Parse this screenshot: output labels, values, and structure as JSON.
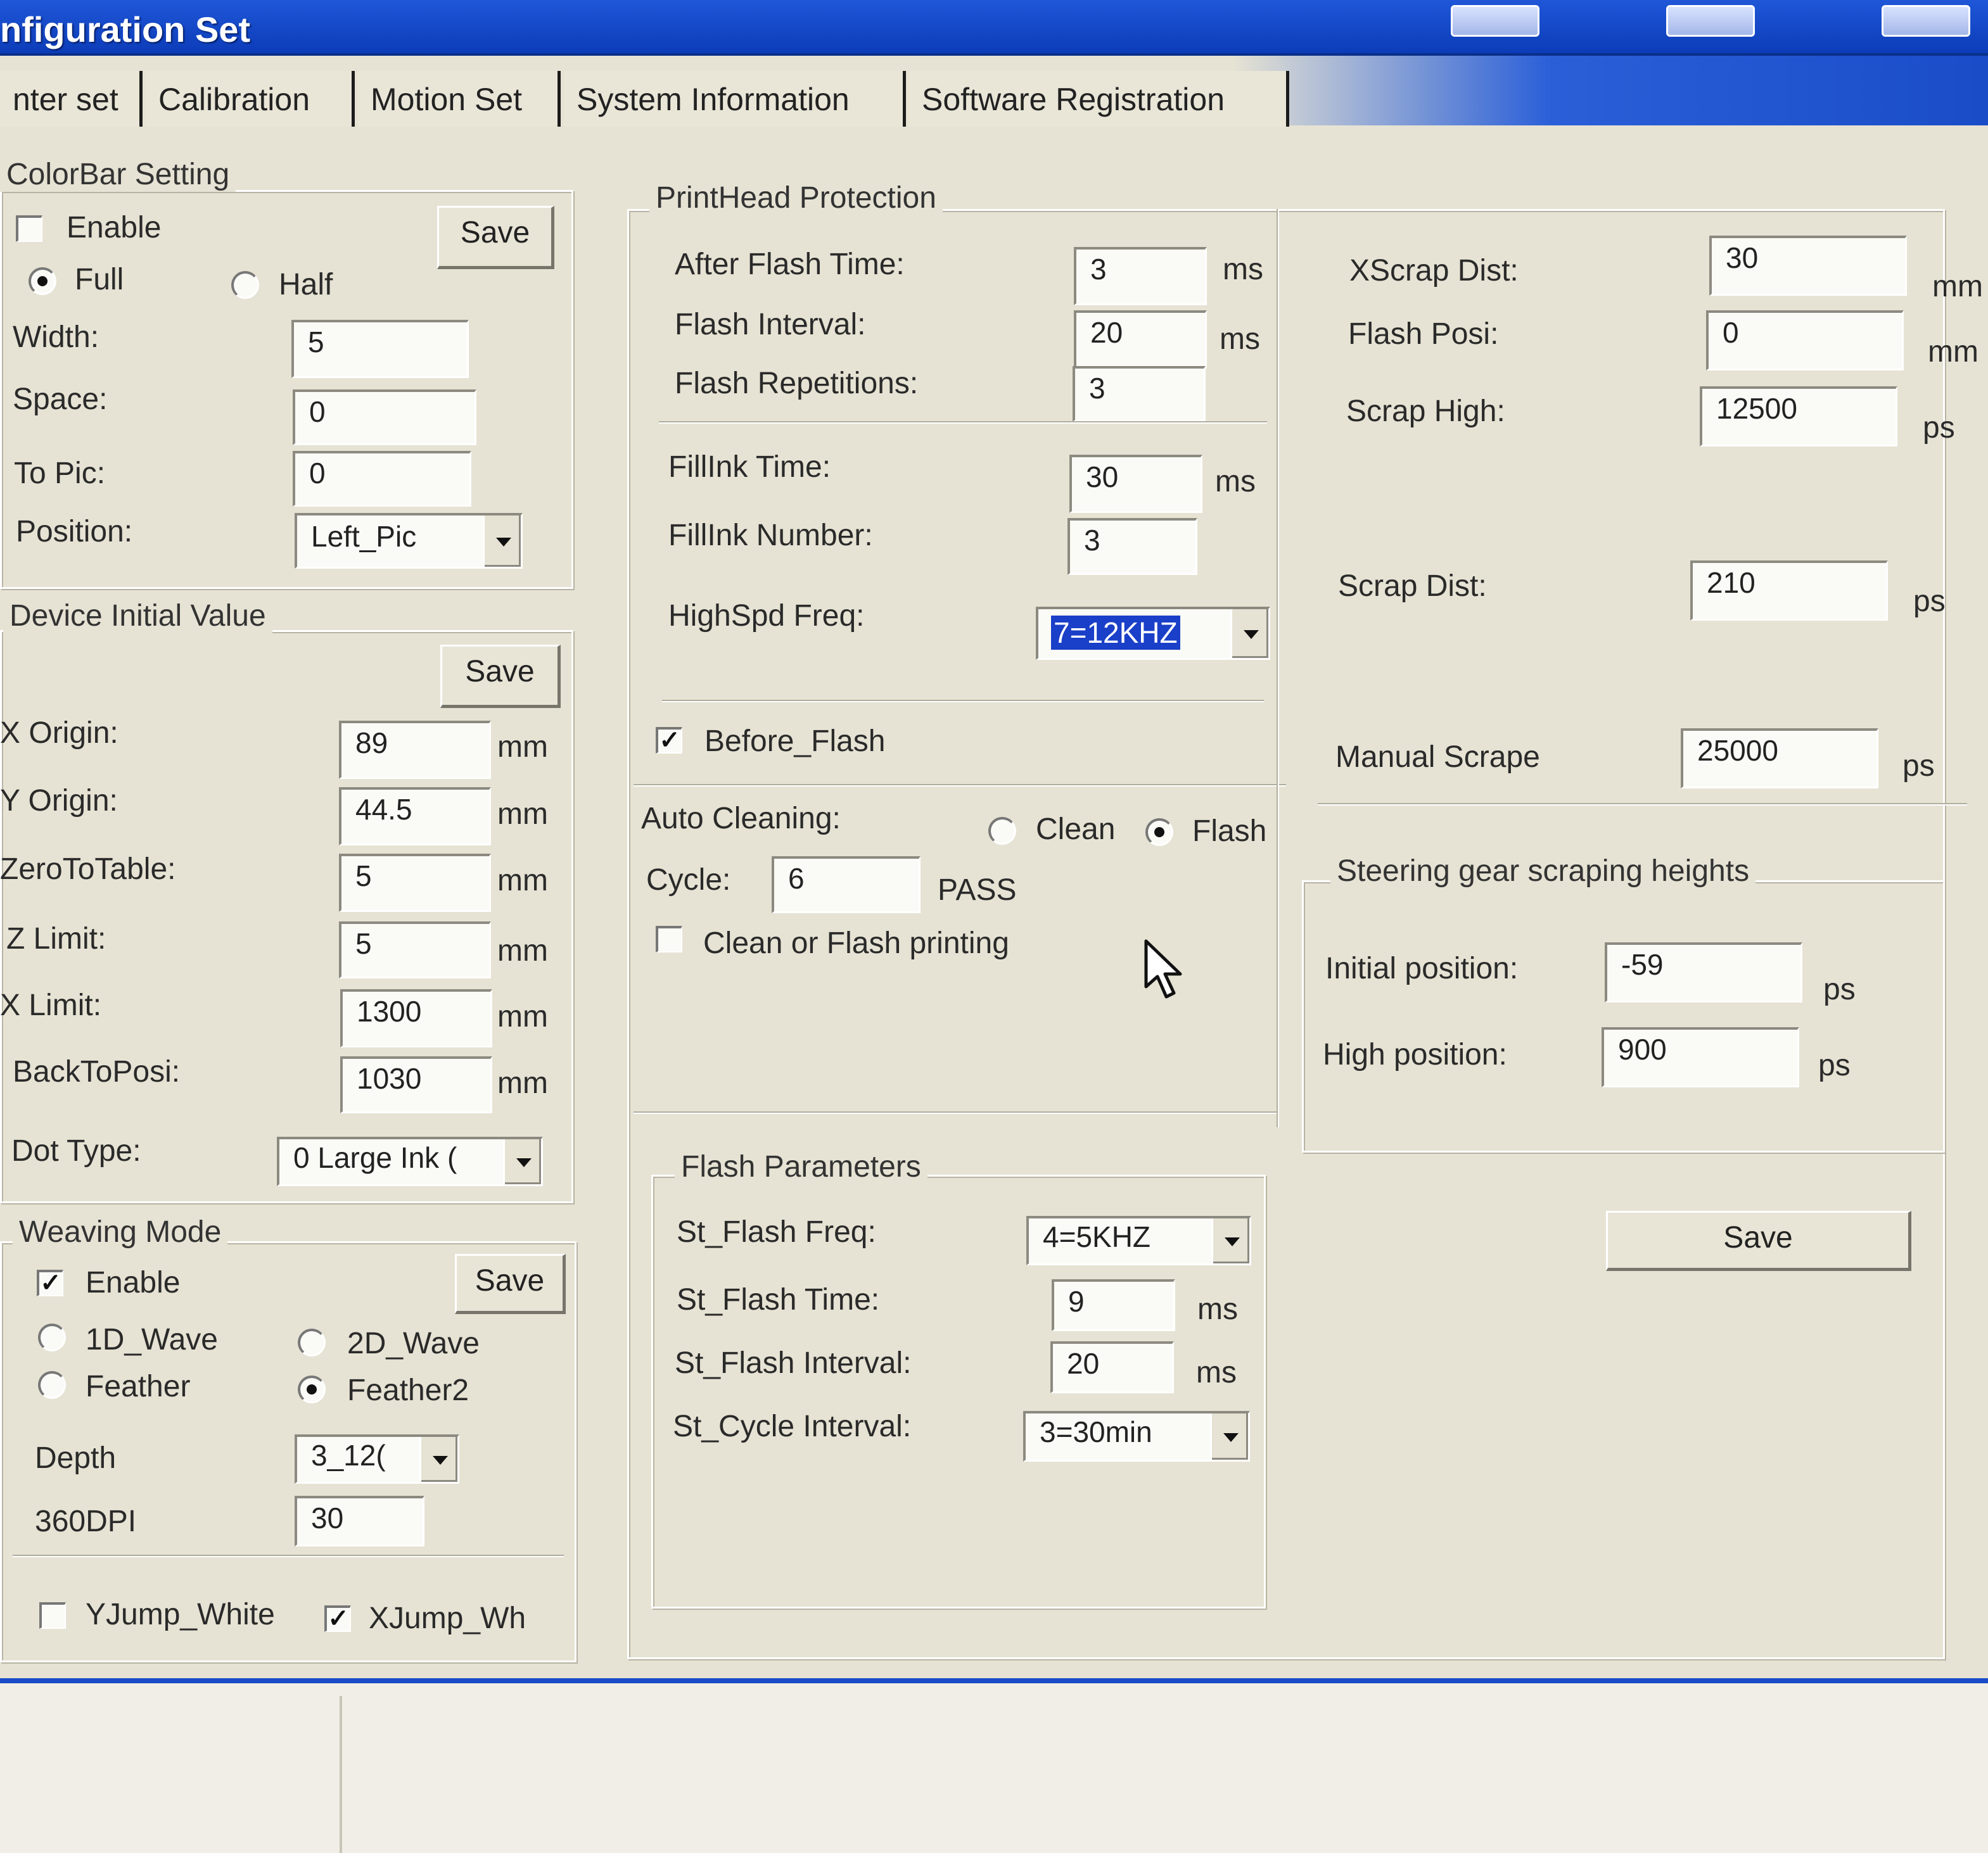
{
  "window": {
    "title": "nfiguration Set"
  },
  "tabs": [
    "nter set",
    "Calibration",
    "Motion Set",
    "System Information",
    "Software Registration"
  ],
  "colorbar": {
    "legend": "ColorBar Setting",
    "enable_label": "Enable",
    "enable_checked": false,
    "save": "Save",
    "full": "Full",
    "half": "Half",
    "width_label": "Width:",
    "width": "5",
    "space_label": "Space:",
    "space": "0",
    "topic_label": "To Pic:",
    "topic": "0",
    "position_label": "Position:",
    "position": "Left_Pic"
  },
  "device": {
    "legend": "Device Initial Value",
    "save": "Save",
    "unit": "mm",
    "rows": [
      {
        "label": "X Origin:",
        "value": "89"
      },
      {
        "label": "Y Origin:",
        "value": "44.5"
      },
      {
        "label": "ZeroToTable:",
        "value": "5"
      },
      {
        "label": "Z Limit:",
        "value": "5"
      },
      {
        "label": "X Limit:",
        "value": "1300"
      },
      {
        "label": "BackToPosi:",
        "value": "1030"
      }
    ],
    "dot_type_label": "Dot Type:",
    "dot_type": "0 Large Ink ("
  },
  "weaving": {
    "legend": "Weaving Mode",
    "enable_label": "Enable",
    "save": "Save",
    "wave1d": "1D_Wave",
    "wave2d": "2D_Wave",
    "feather": "Feather",
    "feather2": "Feather2",
    "depth_label": "Depth",
    "depth": "3_12(",
    "dpi_label": "360DPI",
    "dpi": "30",
    "yjump": "YJump_White",
    "xjump": "XJump_Wh"
  },
  "printhead": {
    "legend": "PrintHead Protection",
    "after_flash_label": "After Flash Time:",
    "after_flash": "3",
    "flash_interval_label": "Flash Interval:",
    "flash_interval": "20",
    "flash_rep_label": "Flash Repetitions:",
    "flash_rep": "3",
    "fillink_time_label": "FillInk Time:",
    "fillink_time": "30",
    "fillink_num_label": "FillInk Number:",
    "fillink_num": "3",
    "highspd_label": "HighSpd Freq:",
    "highspd": "7=12KHZ",
    "before_flash": "Before_Flash",
    "auto_clean_label": "Auto Cleaning:",
    "clean": "Clean",
    "flash": "Flash",
    "cycle_label": "Cycle:",
    "cycle": "6",
    "pass": "PASS",
    "clean_or_flash": "Clean or Flash printing",
    "unit_ms": "ms"
  },
  "flashparams": {
    "legend": "Flash Parameters",
    "freq_label": "St_Flash Freq:",
    "freq": "4=5KHZ",
    "time_label": "St_Flash Time:",
    "time": "9",
    "interval_label": "St_Flash Interval:",
    "interval": "20",
    "cycle_label": "St_Cycle Interval:",
    "cycle": "3=30min"
  },
  "scrape": {
    "xscrap_label": "XScrap Dist:",
    "xscrap": "30",
    "xscrap_unit": "mm",
    "flashposi_label": "Flash Posi:",
    "flashposi": "0",
    "flashposi_unit": "mm",
    "scraphigh_label": "Scrap High:",
    "scraphigh": "12500",
    "scrapdist_label": "Scrap Dist:",
    "scrapdist": "210",
    "manual_label": "Manual Scrape",
    "manual": "25000",
    "unit_ps": "ps"
  },
  "steering": {
    "legend": "Steering gear scraping heights",
    "initial_label": "Initial position:",
    "initial": "-59",
    "high_label": "High position:",
    "high": "900",
    "unit": "ps",
    "save": "Save"
  }
}
